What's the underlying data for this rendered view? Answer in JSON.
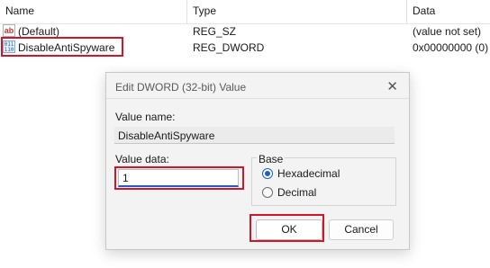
{
  "registry": {
    "columns": {
      "name": "Name",
      "type": "Type",
      "data": "Data"
    },
    "rows": [
      {
        "icon": "string-value-icon",
        "icon_text": "ab",
        "name": "(Default)",
        "type": "REG_SZ",
        "data": "(value not set)"
      },
      {
        "icon": "binary-value-icon",
        "icon_text": "011\n110",
        "name": "DisableAntiSpyware",
        "type": "REG_DWORD",
        "data": "0x00000000 (0)"
      }
    ]
  },
  "dialog": {
    "title": "Edit DWORD (32-bit) Value",
    "close_glyph": "✕",
    "value_name_label": "Value name:",
    "value_name": "DisableAntiSpyware",
    "value_data_label": "Value data:",
    "value_data": "1",
    "base_label": "Base",
    "base_options": [
      "Hexadecimal",
      "Decimal"
    ],
    "base_selected": "Hexadecimal",
    "ok_label": "OK",
    "cancel_label": "Cancel"
  },
  "highlight_color": "#d1162a"
}
